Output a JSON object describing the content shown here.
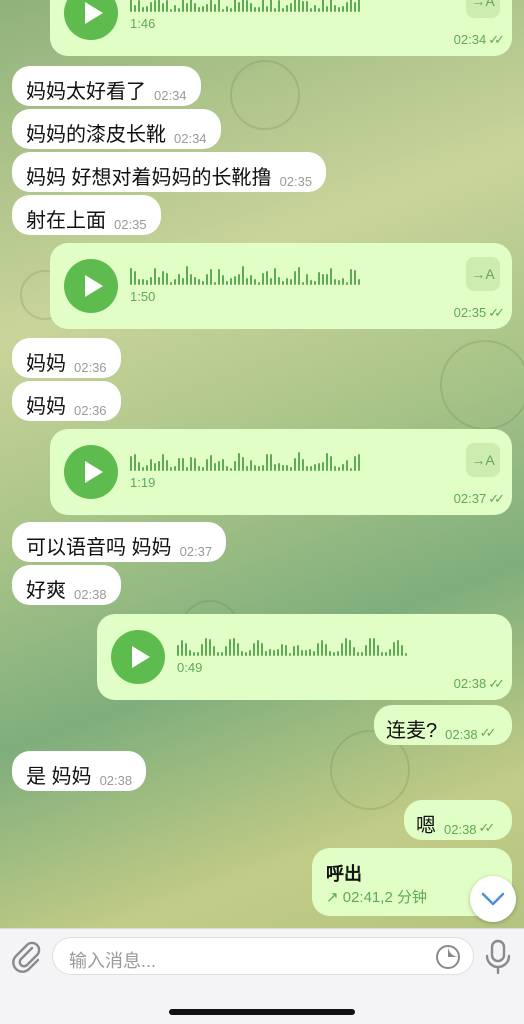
{
  "messages": {
    "v1": {
      "duration": "1:46",
      "time": "02:34"
    },
    "m1": {
      "text": "妈妈太好看了",
      "time": "02:34"
    },
    "m2": {
      "text": "妈妈的漆皮长靴",
      "time": "02:34"
    },
    "m3": {
      "text": "妈妈 好想对着妈妈的长靴撸",
      "time": "02:35"
    },
    "m4": {
      "text": "射在上面",
      "time": "02:35"
    },
    "v2": {
      "duration": "1:50",
      "time": "02:35"
    },
    "m5": {
      "text": "妈妈",
      "time": "02:36"
    },
    "m6": {
      "text": "妈妈",
      "time": "02:36"
    },
    "v3": {
      "duration": "1:19",
      "time": "02:37"
    },
    "m7": {
      "text": "可以语音吗 妈妈",
      "time": "02:37"
    },
    "m8": {
      "text": "好爽",
      "time": "02:38"
    },
    "v4": {
      "duration": "0:49",
      "time": "02:38"
    },
    "m9": {
      "text": "连麦?",
      "time": "02:38"
    },
    "m10": {
      "text": "是 妈妈",
      "time": "02:38"
    },
    "m11": {
      "text": "嗯",
      "time": "02:38"
    },
    "call": {
      "title": "呼出",
      "detail": "↗ 02:41,2 分钟"
    }
  },
  "composer": {
    "placeholder": "输入消息..."
  },
  "icons": {
    "transcribe": "→A",
    "ticks": "✓✓"
  },
  "colors": {
    "outgoing_bubble": "#e1fec6",
    "incoming_bubble": "#ffffff",
    "accent": "#5ebc4f"
  }
}
